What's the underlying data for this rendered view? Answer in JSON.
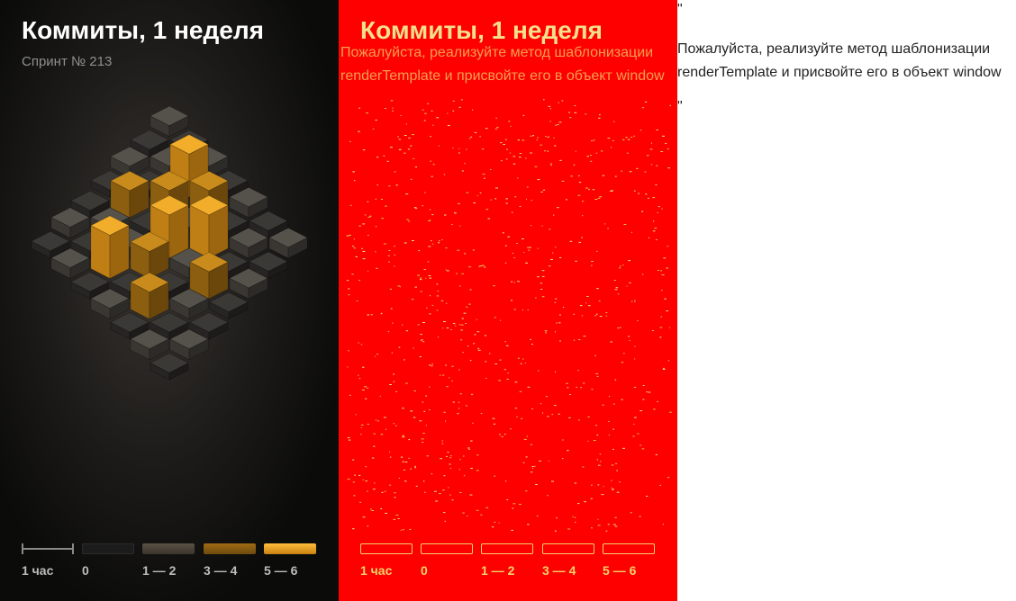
{
  "card": {
    "title": "Коммиты, 1 неделя",
    "subtitle": "Спринт № 213"
  },
  "legend": [
    {
      "label": "1 час",
      "kind": "scale"
    },
    {
      "label": "0",
      "color": "#1c1c1c"
    },
    {
      "label": "1 — 2",
      "color": "#4a4338"
    },
    {
      "label": "3 — 4",
      "color": "#8a5c12"
    },
    {
      "label": "5 — 6",
      "color": "#f0a51c"
    }
  ],
  "colors": {
    "accent": "#ffa000",
    "error_background": "#ff0000",
    "error_foreground": "#f3e08a"
  },
  "error_panel": {
    "title": "Коммиты, 1 неделя",
    "overlay_line1": "Пожалуйста, реализуйте метод шаблонизации",
    "overlay_line2": "renderTemplate и присвойте его в объект window"
  },
  "message": {
    "open_quote": "\"",
    "line1": "Пожалуйста, реализуйте метод шаблонизации",
    "line2": "renderTemplate и присвойте его в объект window",
    "close_quote": "\""
  }
}
